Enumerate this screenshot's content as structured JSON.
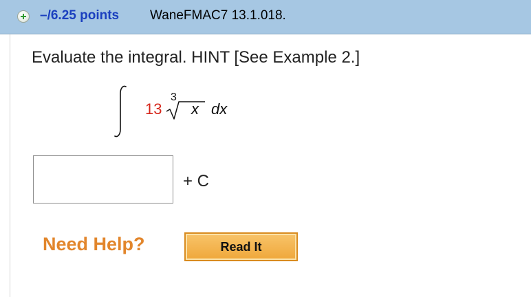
{
  "header": {
    "points_label": "–/6.25 points",
    "question_id": "WaneFMAC7 13.1.018."
  },
  "question": {
    "prompt": "Evaluate the integral. HINT [See Example 2.]",
    "integrand": {
      "coefficient": "13",
      "root_index": "3",
      "radicand": "x",
      "differential": "dx"
    }
  },
  "answer": {
    "value": "",
    "suffix": "+ C"
  },
  "help": {
    "label": "Need Help?",
    "read_it_button": "Read It"
  },
  "colors": {
    "header_bg": "#a6c7e3",
    "points_text": "#1a3fbf",
    "coefficient_text": "#d6261b",
    "help_text": "#e2862c",
    "button_bg": "#efa73a"
  },
  "icons": {
    "expand": "plus-icon"
  }
}
